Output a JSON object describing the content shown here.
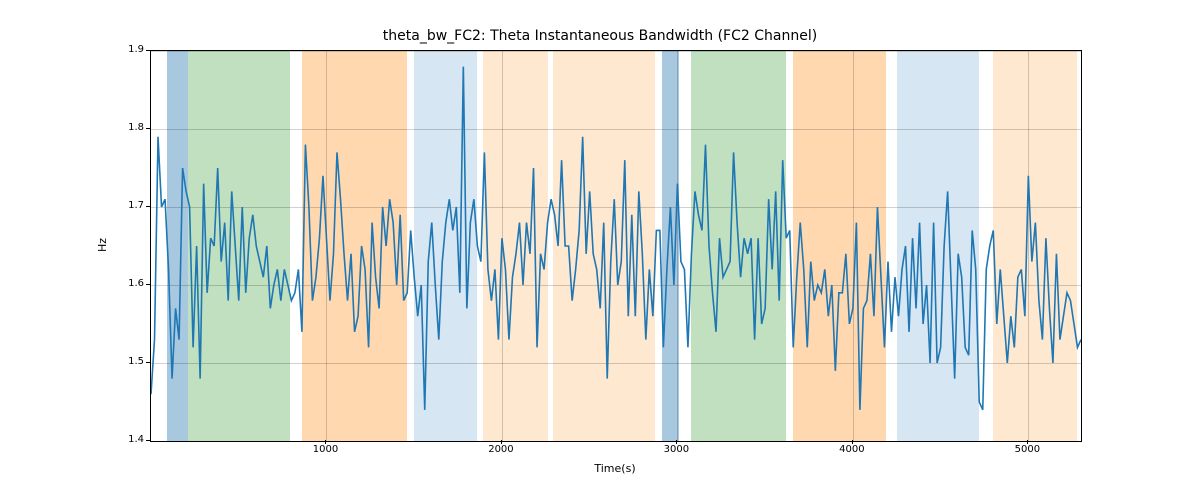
{
  "chart_data": {
    "type": "line",
    "title": "theta_bw_FC2: Theta Instantaneous Bandwidth (FC2 Channel)",
    "xlabel": "Time(s)",
    "ylabel": "Hz",
    "xlim": [
      0,
      5300
    ],
    "ylim": [
      1.4,
      1.9
    ],
    "xticks": [
      1000,
      2000,
      3000,
      4000,
      5000
    ],
    "yticks": [
      1.4,
      1.5,
      1.6,
      1.7,
      1.8,
      1.9
    ],
    "xtick_labels": [
      "1000",
      "2000",
      "3000",
      "4000",
      "5000"
    ],
    "ytick_labels": [
      "1.4",
      "1.5",
      "1.6",
      "1.7",
      "1.8",
      "1.9"
    ],
    "bands": [
      {
        "x0": 90,
        "x1": 210,
        "color": "#a8c8e0"
      },
      {
        "x0": 210,
        "x1": 790,
        "color": "#c0e0c0"
      },
      {
        "x0": 860,
        "x1": 1460,
        "color": "#ffd8b0"
      },
      {
        "x0": 1500,
        "x1": 1860,
        "color": "#d6e6f2"
      },
      {
        "x0": 1890,
        "x1": 2260,
        "color": "#ffe8d0"
      },
      {
        "x0": 2290,
        "x1": 2870,
        "color": "#ffe8d0"
      },
      {
        "x0": 2910,
        "x1": 3010,
        "color": "#a8c8e0"
      },
      {
        "x0": 3080,
        "x1": 3620,
        "color": "#c0e0c0"
      },
      {
        "x0": 3660,
        "x1": 4190,
        "color": "#ffd8b0"
      },
      {
        "x0": 4250,
        "x1": 4720,
        "color": "#d6e6f2"
      },
      {
        "x0": 4800,
        "x1": 5280,
        "color": "#ffe8d0"
      }
    ],
    "x": [
      0,
      20,
      40,
      60,
      80,
      100,
      120,
      140,
      160,
      180,
      200,
      220,
      240,
      260,
      280,
      300,
      320,
      340,
      360,
      380,
      400,
      420,
      440,
      460,
      480,
      500,
      520,
      540,
      560,
      580,
      600,
      620,
      640,
      660,
      680,
      700,
      720,
      740,
      760,
      780,
      800,
      820,
      840,
      860,
      880,
      900,
      920,
      940,
      960,
      980,
      1000,
      1020,
      1040,
      1060,
      1080,
      1100,
      1120,
      1140,
      1160,
      1180,
      1200,
      1220,
      1240,
      1260,
      1280,
      1300,
      1320,
      1340,
      1360,
      1380,
      1400,
      1420,
      1440,
      1460,
      1480,
      1500,
      1520,
      1540,
      1560,
      1580,
      1600,
      1620,
      1640,
      1660,
      1680,
      1700,
      1720,
      1740,
      1760,
      1780,
      1800,
      1820,
      1840,
      1860,
      1880,
      1900,
      1920,
      1940,
      1960,
      1980,
      2000,
      2020,
      2040,
      2060,
      2080,
      2100,
      2120,
      2140,
      2160,
      2180,
      2200,
      2220,
      2240,
      2260,
      2280,
      2300,
      2320,
      2340,
      2360,
      2380,
      2400,
      2420,
      2440,
      2460,
      2480,
      2500,
      2520,
      2540,
      2560,
      2580,
      2600,
      2620,
      2640,
      2660,
      2680,
      2700,
      2720,
      2740,
      2760,
      2780,
      2800,
      2820,
      2840,
      2860,
      2880,
      2900,
      2920,
      2940,
      2960,
      2980,
      3000,
      3020,
      3040,
      3060,
      3080,
      3100,
      3120,
      3140,
      3160,
      3180,
      3200,
      3220,
      3240,
      3260,
      3280,
      3300,
      3320,
      3340,
      3360,
      3380,
      3400,
      3420,
      3440,
      3460,
      3480,
      3500,
      3520,
      3540,
      3560,
      3580,
      3600,
      3620,
      3640,
      3660,
      3680,
      3700,
      3720,
      3740,
      3760,
      3780,
      3800,
      3820,
      3840,
      3860,
      3880,
      3900,
      3920,
      3940,
      3960,
      3980,
      4000,
      4020,
      4040,
      4060,
      4080,
      4100,
      4120,
      4140,
      4160,
      4180,
      4200,
      4220,
      4240,
      4260,
      4280,
      4300,
      4320,
      4340,
      4360,
      4380,
      4400,
      4420,
      4440,
      4460,
      4480,
      4500,
      4520,
      4540,
      4560,
      4580,
      4600,
      4620,
      4640,
      4660,
      4680,
      4700,
      4720,
      4740,
      4760,
      4780,
      4800,
      4820,
      4840,
      4860,
      4880,
      4900,
      4920,
      4940,
      4960,
      4980,
      5000,
      5020,
      5040,
      5060,
      5080,
      5100,
      5120,
      5140,
      5160,
      5180,
      5200,
      5220,
      5240,
      5260,
      5280,
      5300
    ],
    "values": [
      1.46,
      1.53,
      1.79,
      1.7,
      1.71,
      1.62,
      1.48,
      1.57,
      1.53,
      1.75,
      1.72,
      1.7,
      1.52,
      1.65,
      1.48,
      1.73,
      1.59,
      1.66,
      1.65,
      1.75,
      1.63,
      1.68,
      1.58,
      1.72,
      1.65,
      1.58,
      1.7,
      1.59,
      1.66,
      1.69,
      1.65,
      1.63,
      1.61,
      1.65,
      1.57,
      1.6,
      1.62,
      1.58,
      1.62,
      1.6,
      1.58,
      1.59,
      1.62,
      1.54,
      1.78,
      1.7,
      1.58,
      1.61,
      1.66,
      1.74,
      1.66,
      1.58,
      1.64,
      1.77,
      1.71,
      1.64,
      1.58,
      1.64,
      1.54,
      1.56,
      1.65,
      1.62,
      1.52,
      1.68,
      1.61,
      1.57,
      1.7,
      1.65,
      1.71,
      1.68,
      1.6,
      1.69,
      1.58,
      1.59,
      1.67,
      1.61,
      1.56,
      1.6,
      1.44,
      1.63,
      1.68,
      1.6,
      1.53,
      1.63,
      1.68,
      1.71,
      1.67,
      1.7,
      1.59,
      1.88,
      1.57,
      1.68,
      1.71,
      1.65,
      1.63,
      1.77,
      1.62,
      1.58,
      1.62,
      1.53,
      1.66,
      1.62,
      1.53,
      1.61,
      1.64,
      1.68,
      1.6,
      1.68,
      1.64,
      1.75,
      1.52,
      1.64,
      1.62,
      1.68,
      1.71,
      1.69,
      1.65,
      1.76,
      1.65,
      1.65,
      1.58,
      1.62,
      1.67,
      1.79,
      1.64,
      1.72,
      1.64,
      1.62,
      1.57,
      1.68,
      1.48,
      1.63,
      1.71,
      1.6,
      1.63,
      1.76,
      1.56,
      1.69,
      1.56,
      1.72,
      1.64,
      1.53,
      1.62,
      1.56,
      1.67,
      1.67,
      1.52,
      1.62,
      1.7,
      1.6,
      1.73,
      1.63,
      1.62,
      1.52,
      1.64,
      1.72,
      1.69,
      1.67,
      1.78,
      1.65,
      1.59,
      1.54,
      1.66,
      1.61,
      1.62,
      1.63,
      1.77,
      1.68,
      1.61,
      1.66,
      1.64,
      1.66,
      1.53,
      1.66,
      1.55,
      1.57,
      1.71,
      1.62,
      1.72,
      1.58,
      1.76,
      1.66,
      1.67,
      1.52,
      1.61,
      1.68,
      1.62,
      1.52,
      1.63,
      1.58,
      1.6,
      1.59,
      1.62,
      1.56,
      1.6,
      1.49,
      1.59,
      1.59,
      1.64,
      1.55,
      1.57,
      1.68,
      1.44,
      1.57,
      1.58,
      1.64,
      1.56,
      1.7,
      1.61,
      1.52,
      1.63,
      1.54,
      1.61,
      1.56,
      1.62,
      1.65,
      1.54,
      1.66,
      1.57,
      1.68,
      1.55,
      1.6,
      1.5,
      1.68,
      1.5,
      1.52,
      1.65,
      1.72,
      1.6,
      1.48,
      1.64,
      1.61,
      1.52,
      1.51,
      1.67,
      1.62,
      1.45,
      1.44,
      1.62,
      1.65,
      1.67,
      1.55,
      1.62,
      1.56,
      1.5,
      1.56,
      1.52,
      1.61,
      1.62,
      1.56,
      1.74,
      1.63,
      1.68,
      1.58,
      1.53,
      1.66,
      1.57,
      1.5,
      1.64,
      1.53,
      1.56,
      1.59,
      1.58,
      1.55,
      1.52,
      1.53
    ]
  }
}
